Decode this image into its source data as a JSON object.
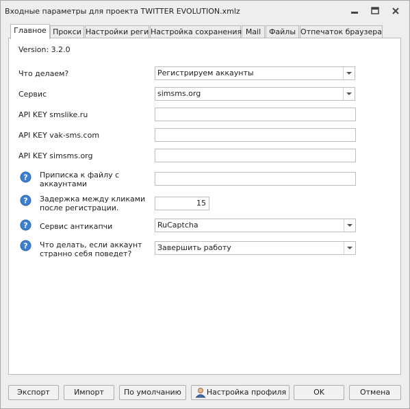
{
  "window": {
    "title": "Входные параметры для проекта TWITTER EVOLUTION.xmlz",
    "controls": [
      "minimize-icon",
      "restore-icon",
      "close-icon"
    ]
  },
  "tabs": [
    {
      "label": "Главное",
      "active": true
    },
    {
      "label": "Прокси",
      "active": false
    },
    {
      "label": "Настройки реги",
      "active": false
    },
    {
      "label": "Настройка сохранения",
      "active": false
    },
    {
      "label": "Mail",
      "active": false
    },
    {
      "label": "Файлы",
      "active": false
    },
    {
      "label": "Отпечаток браузера",
      "active": false
    }
  ],
  "version": "Version: 3.2.0",
  "fields": [
    {
      "label": "Что делаем?",
      "type": "combo",
      "value": "Регистрируем аккаунты"
    },
    {
      "label": "Сервис",
      "type": "combo",
      "value": "simsms.org"
    },
    {
      "label": "API KEY smslike.ru",
      "type": "text",
      "value": ""
    },
    {
      "label": "API KEY vak-sms.com",
      "type": "text",
      "value": ""
    },
    {
      "label": "API KEY simsms.org",
      "type": "text",
      "value": ""
    },
    {
      "label_lines": [
        "Приписка к файлу с",
        "аккаунтами"
      ],
      "type": "text",
      "value": "",
      "help": true
    },
    {
      "label_lines": [
        "Задержка между кликами",
        "после регистрации."
      ],
      "type": "number",
      "value": "15",
      "help": true
    },
    {
      "label": "Сервис антикапчи",
      "type": "combo",
      "value": "RuCaptcha",
      "help": true
    },
    {
      "label_lines": [
        "Что делать, если аккаунт",
        "странно себя поведет?"
      ],
      "type": "combo",
      "value": "Завершить работу",
      "help": true
    }
  ],
  "buttons": {
    "export": "Экспорт",
    "import": "Импорт",
    "defaults": "По умолчанию",
    "profile": "Настройка профиля",
    "ok": "OK",
    "cancel": "Отмена"
  },
  "colors": {
    "help_icon": "#3d7fd1",
    "window_bg": "#eeeeee",
    "border": "#b9b9b9"
  }
}
